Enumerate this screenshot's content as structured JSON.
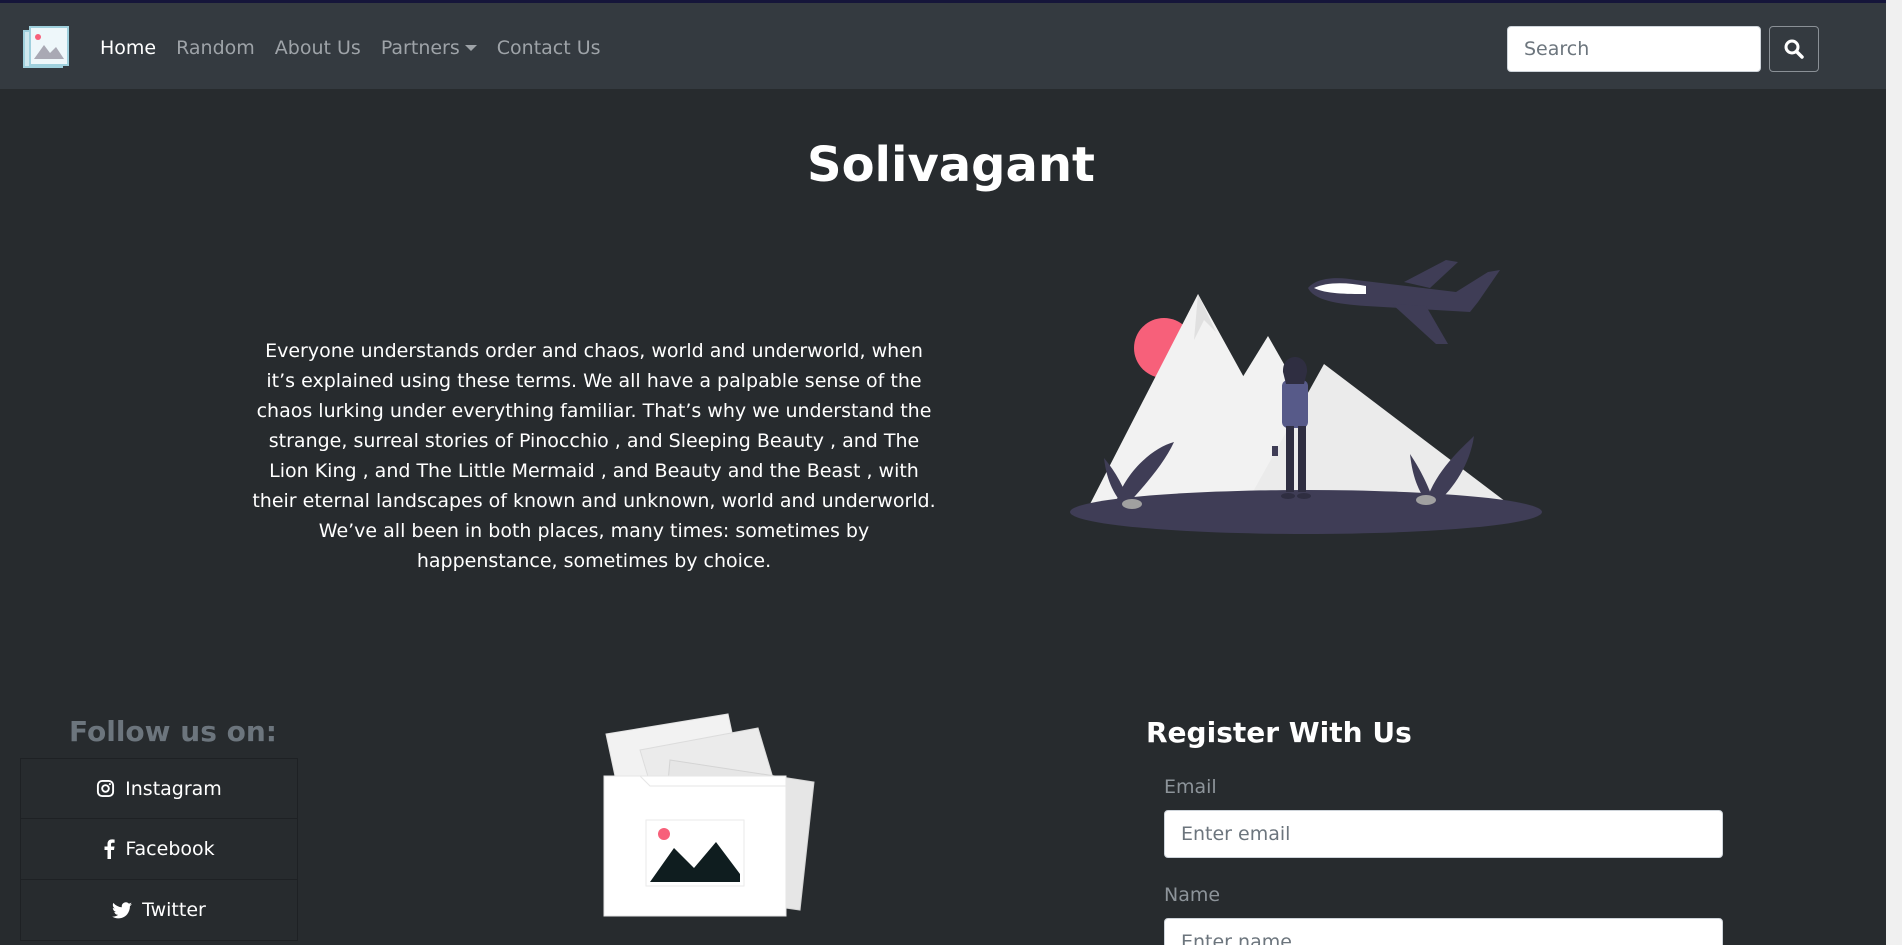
{
  "nav": {
    "links": [
      "Home",
      "Random",
      "About Us",
      "Partners",
      "Contact Us"
    ],
    "search_placeholder": "Search"
  },
  "hero": {
    "title": "Solivagant",
    "text": "Everyone understands order and chaos, world and underworld, when it’s explained using these terms. We all have a palpable sense of the chaos lurking under everything familiar. That’s why we understand the strange, surreal stories of Pinocchio , and Sleeping Beauty , and The Lion King , and The Little Mermaid , and Beauty and the Beast , with their eternal landscapes of known and unknown, world and underworld. We’ve all been in both places, many times: sometimes by happenstance, sometimes by choice."
  },
  "social": {
    "title": "Follow us on:",
    "items": [
      "Instagram",
      "Facebook",
      "Twitter"
    ]
  },
  "register": {
    "title": "Register With Us",
    "email_label": "Email",
    "email_placeholder": "Enter email",
    "name_label": "Name",
    "name_placeholder": "Enter name"
  },
  "colors": {
    "background": "#272b2e",
    "navbar": "#343a40",
    "accent_pink": "#f7607a",
    "illustration_dark": "#3f3d56"
  }
}
